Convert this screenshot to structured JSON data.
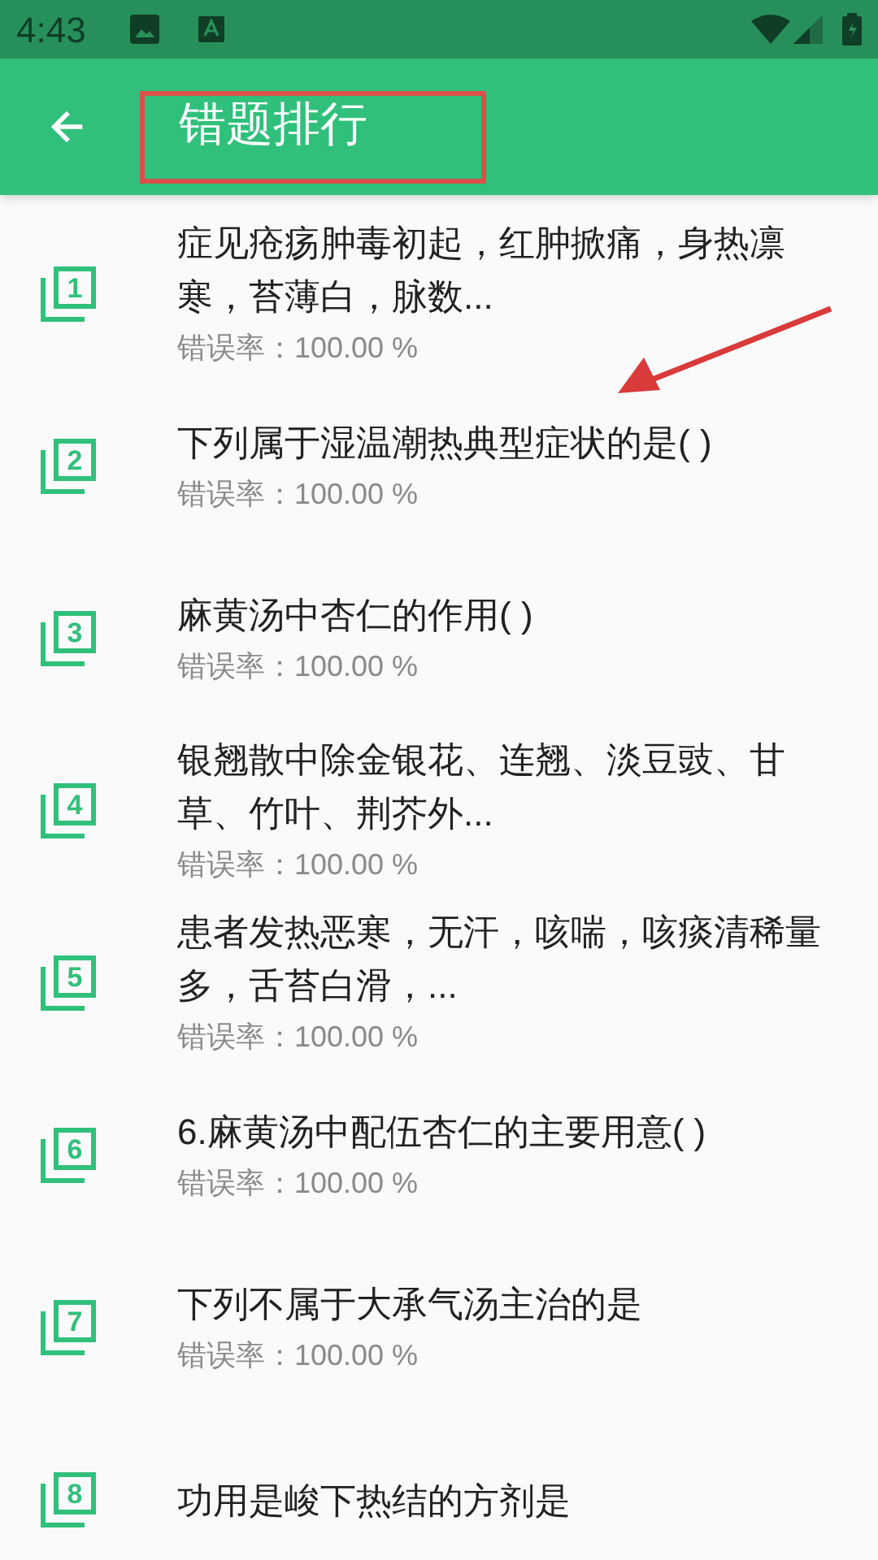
{
  "status_bar": {
    "time": "4:43"
  },
  "app_bar": {
    "title": "错题排行"
  },
  "questions": [
    {
      "number": "1",
      "title": "症见疮疡肿毒初起，红肿掀痛，身热凛寒，苔薄白，脉数...",
      "rate": "错误率：100.00 %"
    },
    {
      "number": "2",
      "title": "下列属于湿温潮热典型症状的是(   )",
      "rate": "错误率：100.00 %"
    },
    {
      "number": "3",
      "title": "麻黄汤中杏仁的作用(   )",
      "rate": "错误率：100.00 %"
    },
    {
      "number": "4",
      "title": "银翘散中除金银花、连翘、淡豆豉、甘草、竹叶、荆芥外...",
      "rate": "错误率：100.00 %"
    },
    {
      "number": "5",
      "title": "患者发热恶寒，无汗，咳喘，咳痰清稀量多，舌苔白滑，...",
      "rate": "错误率：100.00 %"
    },
    {
      "number": "6",
      "title": "6.麻黄汤中配伍杏仁的主要用意(   )",
      "rate": "错误率：100.00 %"
    },
    {
      "number": "7",
      "title": "下列不属于大承气汤主治的是",
      "rate": "错误率：100.00 %"
    },
    {
      "number": "8",
      "title": "功用是峻下热结的方剂是"
    }
  ]
}
